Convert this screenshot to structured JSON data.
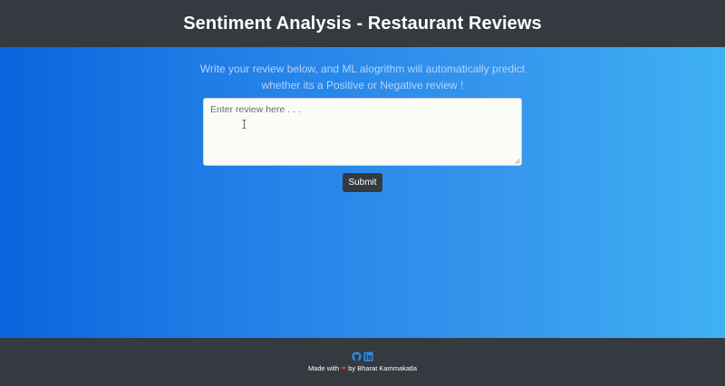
{
  "header": {
    "title": "Sentiment Analysis - Restaurant Reviews"
  },
  "main": {
    "subtitle": "Write your review below, and ML alogrithm will automatically predict whether its a Positive or Negative review !",
    "review_placeholder": "Enter review here . . .",
    "review_value": "",
    "submit_label": "Submit"
  },
  "footer": {
    "made_with": "Made with",
    "heart_icon": "heart-icon",
    "by_text": "by Bharat Kammakatla",
    "icons": [
      "github-icon",
      "linkedin-icon"
    ]
  },
  "colors": {
    "header_bg": "#343a40",
    "gradient_start": "#0a64dc",
    "gradient_end": "#3fb1f4",
    "icon_blue": "#2f86e6",
    "heart": "#e53935"
  }
}
